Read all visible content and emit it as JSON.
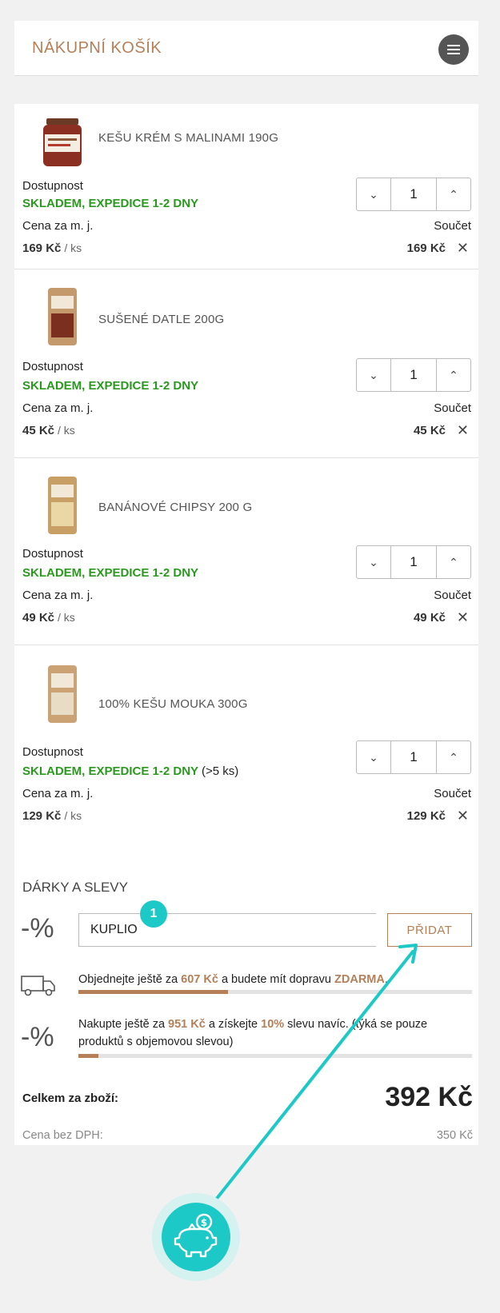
{
  "header": {
    "title": "NÁKUPNÍ KOŠÍK"
  },
  "labels": {
    "availability": "Dostupnost",
    "unit_price": "Cena za m. j.",
    "sum": "Součet",
    "per_unit": "/ ks",
    "remove": "✕",
    "qty_decrease": "⌄",
    "qty_increase": "⌃"
  },
  "items": [
    {
      "name": "KEŠU KRÉM S MALINAMI 190G",
      "availability": "SKLADEM, EXPEDICE 1-2 DNY",
      "availability_note": "",
      "qty": "1",
      "unit_price": "169 Kč",
      "sum": "169 Kč"
    },
    {
      "name": "SUŠENÉ DATLE 200G",
      "availability": "SKLADEM, EXPEDICE 1-2 DNY",
      "availability_note": "",
      "qty": "1",
      "unit_price": "45 Kč",
      "sum": "45 Kč"
    },
    {
      "name": "BANÁNOVÉ CHIPSY 200 G",
      "availability": "SKLADEM, EXPEDICE 1-2 DNY",
      "availability_note": "",
      "qty": "1",
      "unit_price": "49 Kč",
      "sum": "49 Kč"
    },
    {
      "name": "100% KEŠU MOUKA 300G",
      "availability": "SKLADEM, EXPEDICE 1-2 DNY",
      "availability_note": "(>5 ks)",
      "qty": "1",
      "unit_price": "129 Kč",
      "sum": "129 Kč"
    }
  ],
  "gifts": {
    "title": "DÁRKY A SLEVY",
    "percent_icon": "-%",
    "coupon_value": "KUPLIO",
    "add_button": "PŘIDAT",
    "badge": "1",
    "shipping": {
      "text_1": "Objednejte ještě za ",
      "amount": "607 Kč",
      "text_2": " a budete mít dopravu ",
      "free": "ZDARMA",
      "text_3": ".",
      "progress": 0.38
    },
    "discount": {
      "text_1": "Nakupte ještě za ",
      "amount": "951 Kč",
      "text_2": " a získejte ",
      "percent": "10%",
      "text_3": " slevu navíc. (týká se pouze produktů s objemovou slevou)",
      "progress": 0.05
    }
  },
  "totals": {
    "total_label": "Celkem za zboží:",
    "total_value": "392 Kč",
    "net_label": "Cena bez DPH:",
    "net_value": "350 Kč"
  },
  "colors": {
    "accent": "#b57f58",
    "stock": "#2a9a1f",
    "teal": "#1cc9c6"
  },
  "icons": [
    "menu-icon",
    "truck-icon",
    "piggy-bank-icon"
  ]
}
